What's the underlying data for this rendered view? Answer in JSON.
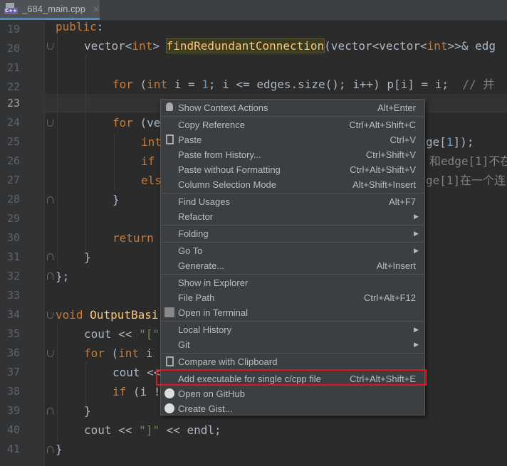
{
  "tab": {
    "filename": "_684_main.cpp",
    "close": "×",
    "file_badge": "C++"
  },
  "line_numbers": [
    "19",
    "20",
    "21",
    "22",
    "23",
    "24",
    "25",
    "26",
    "27",
    "28",
    "29",
    "30",
    "31",
    "32",
    "33",
    "34",
    "35",
    "36",
    "37",
    "38",
    "39",
    "40",
    "41"
  ],
  "code": {
    "l19": {
      "kw": "public",
      "rest": ":"
    },
    "l20": {
      "t1": "vector<",
      "t2": "int",
      "t3": "> ",
      "fn": "findRedundantConnection",
      "t4": "(vector<vector<",
      "t5": "int",
      "t6": ">>& edg"
    },
    "l22": {
      "k1": "for",
      "p1": " (",
      "k2": "int",
      "t1": " i = ",
      "n1": "1",
      "t2": "; i <= edges.size",
      "t3": "(); i++) p[i] = i;  ",
      "cmt": "// 并"
    },
    "l24": {
      "kw": "for",
      "t1": " (ve"
    },
    "l25": {
      "kw": "int",
      "t1": "ge[",
      "n1": "1",
      "t2": "]);"
    },
    "l26": {
      "kw": "if",
      "t1": "和edge[1]不在"
    },
    "l27": {
      "kw": "els",
      "t1": "ge[1]在一个连"
    },
    "l28": {
      "t1": "}"
    },
    "l30": {
      "kw": "return"
    },
    "l31": {
      "t1": "}"
    },
    "l32": {
      "t1": "};"
    },
    "l34": {
      "kw": "void",
      "fn": "OutputBasi"
    },
    "l35": {
      "t1": "cout << ",
      "str": "\"[\""
    },
    "l36": {
      "kw1": "for",
      "p1": " (",
      "kw2": "int",
      "t1": " i"
    },
    "l37": {
      "t1": "cout <<"
    },
    "l38": {
      "kw": "if",
      "t1": " (i !"
    },
    "l39": {
      "t1": "}"
    },
    "l40": {
      "t1": "cout << ",
      "str": "\"]\"",
      "t2": " << endl;"
    },
    "l41": {
      "t1": "}"
    }
  },
  "menu": {
    "items": [
      {
        "label": "Show Context Actions",
        "shortcut": "Alt+Enter",
        "icon": "lightbulb-icon"
      },
      {
        "label": "Copy Reference",
        "shortcut": "Ctrl+Alt+Shift+C"
      },
      {
        "label": "Paste",
        "shortcut": "Ctrl+V",
        "icon": "clipboard-icon"
      },
      {
        "label": "Paste from History...",
        "shortcut": "Ctrl+Shift+V"
      },
      {
        "label": "Paste without Formatting",
        "shortcut": "Ctrl+Alt+Shift+V"
      },
      {
        "label": "Column Selection Mode",
        "shortcut": "Alt+Shift+Insert"
      },
      {
        "label": "Find Usages",
        "shortcut": "Alt+F7"
      },
      {
        "label": "Refactor",
        "submenu": true
      },
      {
        "label": "Folding",
        "submenu": true
      },
      {
        "label": "Go To",
        "submenu": true
      },
      {
        "label": "Generate...",
        "shortcut": "Alt+Insert"
      },
      {
        "label": "Show in Explorer"
      },
      {
        "label": "File Path",
        "shortcut": "Ctrl+Alt+F12"
      },
      {
        "label": "Open in Terminal",
        "icon": "terminal-icon"
      },
      {
        "label": "Local History",
        "submenu": true
      },
      {
        "label": "Git",
        "submenu": true
      },
      {
        "label": "Compare with Clipboard",
        "icon": "compare-icon"
      },
      {
        "label": "Add executable for single c/cpp file",
        "shortcut": "Ctrl+Alt+Shift+E",
        "highlighted": true
      },
      {
        "label": "Open on GitHub",
        "icon": "github-icon"
      },
      {
        "label": "Create Gist...",
        "icon": "github-icon"
      }
    ],
    "submenu_arrow": "▶"
  }
}
